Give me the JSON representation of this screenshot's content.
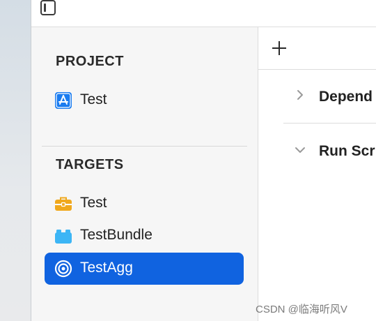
{
  "toolbar": {
    "sidebar_toggle_icon": "sidebar-toggle-icon"
  },
  "sidebar": {
    "project_title": "PROJECT",
    "project_items": [
      {
        "label": "Test",
        "icon": "app-store-icon"
      }
    ],
    "targets_title": "TARGETS",
    "target_items": [
      {
        "label": "Test",
        "icon": "toolbox-icon"
      },
      {
        "label": "TestBundle",
        "icon": "lego-brick-icon"
      },
      {
        "label": "TestAgg",
        "icon": "target-icon",
        "selected": true
      }
    ]
  },
  "editor": {
    "add_icon": "plus-icon",
    "phases": [
      {
        "label": "Depend",
        "expanded": false
      },
      {
        "label": "Run Scr",
        "expanded": true
      }
    ]
  },
  "watermark": "CSDN @临海听风V",
  "colors": {
    "selection": "#1063e0",
    "app_icon_blue": "#1a7cf0",
    "toolbox_yellow": "#f0a81c",
    "bundle_blue": "#3cb5f5"
  }
}
